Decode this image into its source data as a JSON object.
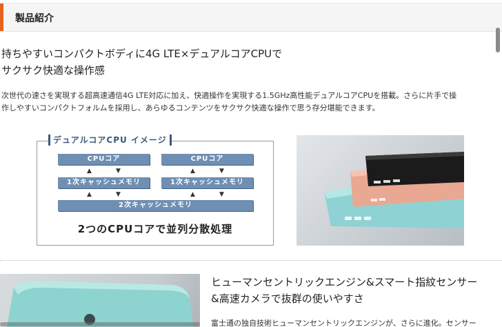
{
  "section": {
    "title": "製品紹介"
  },
  "feature1": {
    "heading_line1": "持ちやすいコンパクトボディに4G LTE×デュアルコアCPUで",
    "heading_line2": "サクサク快適な操作感",
    "body_line1": "次世代の速さを実現する超高速通信4G LTE対応に加え、快適操作を実現する1.5GHz高性能デュアルコアCPUを搭載。さらに片手で操",
    "body_line2": "作しやすいコンパクトフォルムを採用し、あらゆるコンテンツをサクサク快適な操作で思う存分堪能できます。"
  },
  "diagram": {
    "legend": "デュアルコアCPU イメージ",
    "cpu_core_1": "CPUコア",
    "cpu_core_2": "CPUコア",
    "l1_cache_1": "1次キャッシュメモリ",
    "l1_cache_2": "1次キャッシュメモリ",
    "l2_cache": "2次キャッシュメモリ",
    "arrow_up": "▲",
    "arrow_down": "▼",
    "caption": "2つのCPUコアで並列分散処理"
  },
  "feature2": {
    "heading_line1": "ヒューマンセントリックエンジン&スマート指紋センサー",
    "heading_line2": "&高速カメラで抜群の使いやすさ",
    "body_line1": "富士通の独自技術ヒューマンセントリックエンジンが、さらに進化。センサー"
  },
  "colors": {
    "accent": "#e8641c",
    "diagram_box": "#6f8fb3",
    "diagram_text": "#3c5a7a"
  },
  "icons": [
    "phone-product-photo",
    "phone-product-photo-2"
  ]
}
